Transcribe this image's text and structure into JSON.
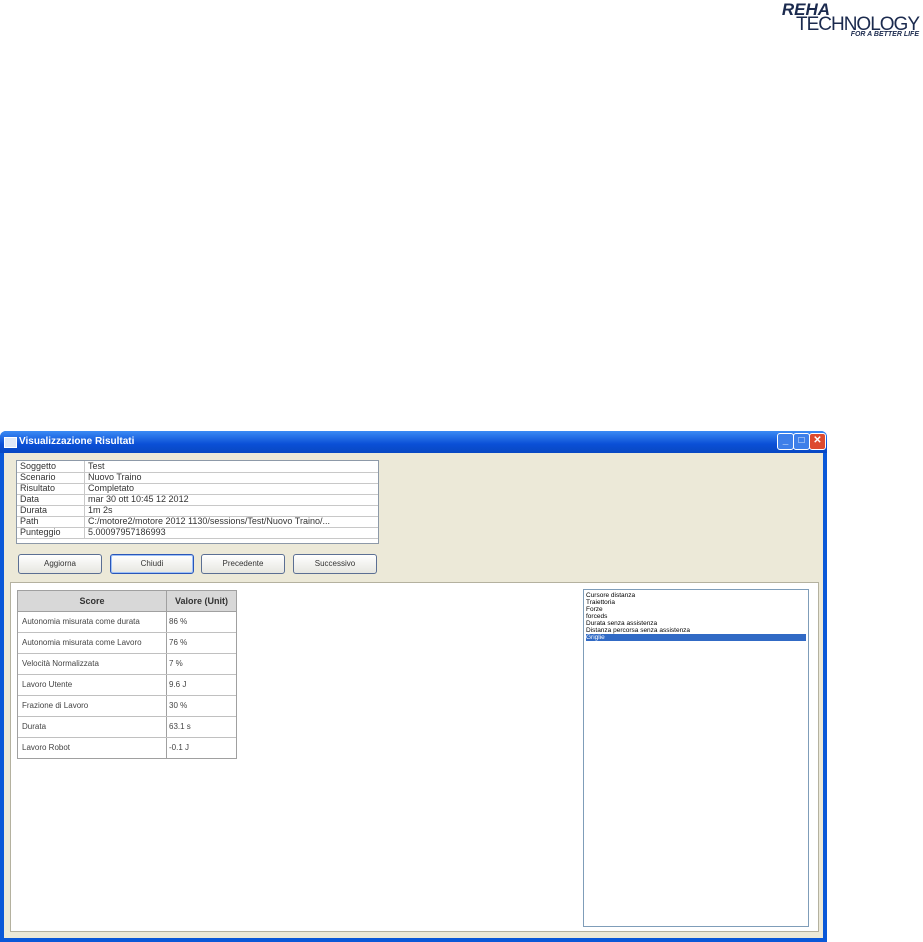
{
  "logo": {
    "brand_top": "REHA",
    "brand_main": "TECHNOLOGY",
    "tagline": "FOR A BETTER LIFE"
  },
  "window": {
    "title": "Visualizzazione Risultati",
    "controls": {
      "minimize": "_",
      "maximize": "□",
      "close": "✕"
    }
  },
  "info": {
    "rows": [
      {
        "label": "Soggetto",
        "value": "Test"
      },
      {
        "label": "Scenario",
        "value": "Nuovo Traino"
      },
      {
        "label": "Risultato",
        "value": "Completato"
      },
      {
        "label": "Data",
        "value": "mar 30 ott 10:45 12 2012"
      },
      {
        "label": "Durata",
        "value": "1m 2s"
      },
      {
        "label": "Path",
        "value": "C:/motore2/motore 2012 1130/sessions/Test/Nuovo Traino/..."
      },
      {
        "label": "Punteggio",
        "value": "5.00097957186993"
      }
    ]
  },
  "buttons": {
    "refresh": "Aggiorna",
    "close": "Chiudi",
    "previous": "Precedente",
    "next": "Successivo"
  },
  "scores": {
    "headers": {
      "score": "Score",
      "value": "Valore (Unit)"
    },
    "rows": [
      {
        "score": "Autonomia misurata come durata",
        "value": "86 %"
      },
      {
        "score": "Autonomia misurata come Lavoro",
        "value": "76 %"
      },
      {
        "score": "Velocità Normalizzata",
        "value": "7 %"
      },
      {
        "score": "Lavoro Utente",
        "value": "9.6 J"
      },
      {
        "score": "Frazione di Lavoro",
        "value": "30 %"
      },
      {
        "score": "Durata",
        "value": "63.1 s"
      },
      {
        "score": "Lavoro Robot",
        "value": "-0.1 J"
      }
    ]
  },
  "graph_list": {
    "items": [
      "Cursore distanza",
      "Traiettoria",
      "Forze",
      "forceds",
      "Durata senza assistenza",
      "Distanza percorsa senza assistenza",
      "Griglie"
    ],
    "selected_index": 6
  }
}
